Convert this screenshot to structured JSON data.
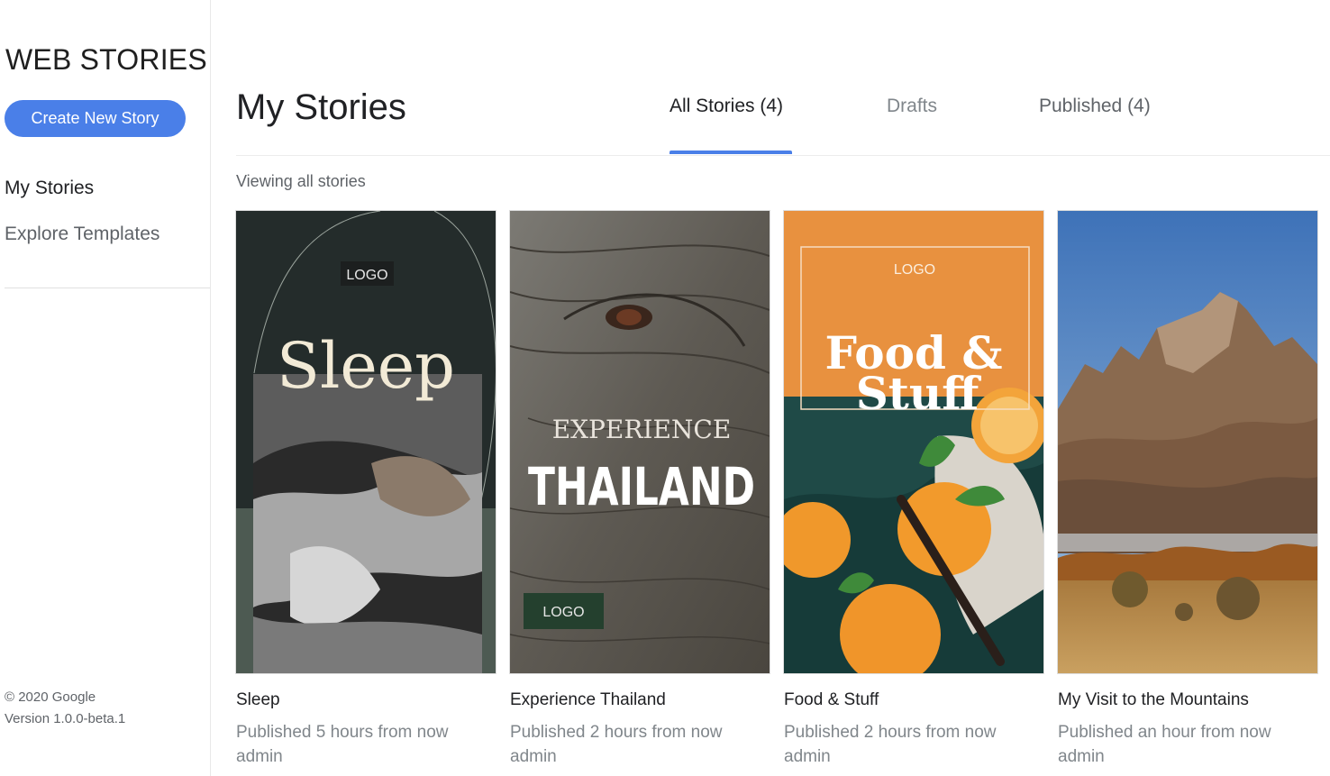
{
  "sidebar": {
    "brand": "WEB STORIES",
    "create_button": "Create New Story",
    "nav": [
      {
        "label": "My Stories"
      },
      {
        "label": "Explore Templates"
      }
    ],
    "footer": {
      "copyright": "© 2020 Google",
      "version": "Version 1.0.0-beta.1"
    }
  },
  "header": {
    "title": "My Stories",
    "tabs": [
      {
        "label": "All Stories (4)",
        "active": true
      },
      {
        "label": "Drafts",
        "active": false
      },
      {
        "label": "Published (4)",
        "active": false
      }
    ],
    "viewing_text": "Viewing all stories"
  },
  "colors": {
    "accent": "#4a7fe8"
  },
  "stories": [
    {
      "title": "Sleep",
      "status": "Published 5 hours from now",
      "author": "admin",
      "thumb": {
        "logo": "LOGO",
        "headline": "Sleep"
      }
    },
    {
      "title": "Experience Thailand",
      "status": "Published 2 hours from now",
      "author": "admin",
      "thumb": {
        "kicker": "EXPERIENCE",
        "headline": "THAILAND",
        "logo": "LOGO"
      }
    },
    {
      "title": "Food & Stuff",
      "status": "Published 2 hours from now",
      "author": "admin",
      "thumb": {
        "logo": "LOGO",
        "headline_line1": "Food &",
        "headline_line2": "Stuff"
      }
    },
    {
      "title": "My Visit to the Mountains",
      "status": "Published an hour from now",
      "author": "admin"
    }
  ]
}
